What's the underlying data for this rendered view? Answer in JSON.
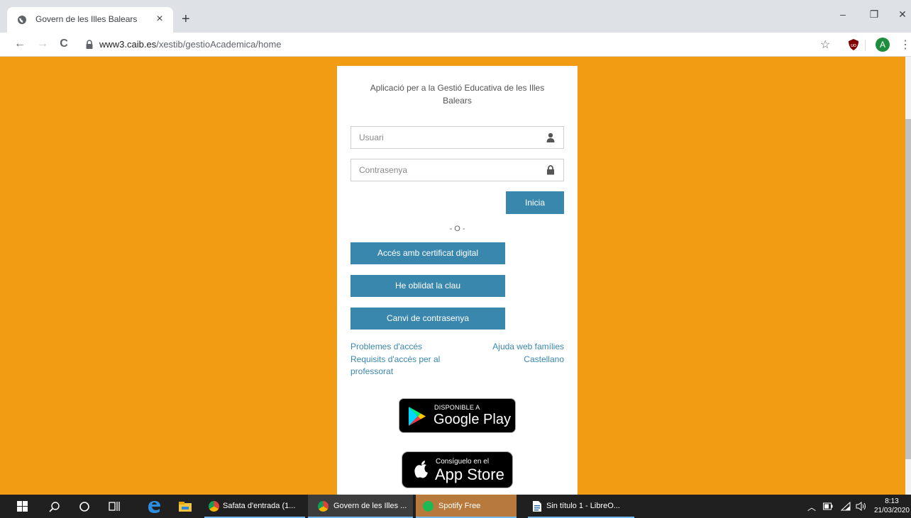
{
  "browser": {
    "tab_title": "Govern de les Illes Balears",
    "tab_close": "×",
    "new_tab": "+",
    "minimize": "–",
    "restore": "❐",
    "close": "✕",
    "back": "←",
    "forward": "→",
    "reload": "C",
    "url_host": "www3.caib.es",
    "url_path": "/xestib/gestioAcademica/home",
    "bookmark_star": "☆",
    "profile_initial": "A",
    "menu": "⋮"
  },
  "login": {
    "app_title": "Aplicació per a la Gestió Educativa de les Illes Balears",
    "username_placeholder": "Usuari",
    "password_placeholder": "Contrasenya",
    "start_button": "Inicia",
    "or_separator": "- O -",
    "certificate_button": "Accés amb certificat digital",
    "forgot_button": "He oblidat la clau",
    "change_password_button": "Canvi de contrasenya",
    "links": {
      "access_problems": "Problemes d'accés",
      "family_help": "Ajuda web famílies",
      "teacher_requirements": "Requisits d'accés per al professorat",
      "spanish": "Castellano"
    },
    "google_play": {
      "small": "DISPONIBLE A",
      "big": "Google Play"
    },
    "app_store": {
      "small": "Consíguelo en el",
      "big": "App Store"
    }
  },
  "taskbar": {
    "tasks": [
      {
        "label": "Safata d'entrada (1...",
        "icon": "chrome-icon"
      },
      {
        "label": "Govern de les Illes ...",
        "icon": "chrome-icon"
      },
      {
        "label": "Spotify Free",
        "icon": "spotify-icon"
      },
      {
        "label": "Sin título 1 - LibreO...",
        "icon": "libreoffice-writer-icon"
      }
    ],
    "time": "8:13",
    "date": "21/03/2020"
  },
  "colors": {
    "page_background": "#f29c13",
    "button": "#3a87ad",
    "link": "#3a87ad"
  }
}
